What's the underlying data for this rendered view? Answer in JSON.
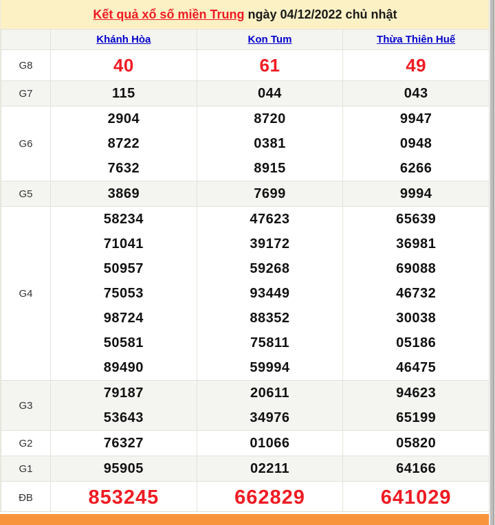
{
  "title": {
    "link": "Kết quả xổ số miền Trung",
    "rest": " ngày 04/12/2022 chủ nhật"
  },
  "table": {
    "columns": [
      "Khánh Hòa",
      "Kon Tum",
      "Thừa Thiên Huế"
    ],
    "rows": [
      {
        "label": "G8",
        "style": "red-medium",
        "stripe": false,
        "values": [
          [
            "40"
          ],
          [
            "61"
          ],
          [
            "49"
          ]
        ]
      },
      {
        "label": "G7",
        "style": "normal",
        "stripe": true,
        "values": [
          [
            "115"
          ],
          [
            "044"
          ],
          [
            "043"
          ]
        ]
      },
      {
        "label": "G6",
        "style": "normal",
        "stripe": false,
        "values": [
          [
            "2904",
            "8722",
            "7632"
          ],
          [
            "8720",
            "0381",
            "8915"
          ],
          [
            "9947",
            "0948",
            "6266"
          ]
        ]
      },
      {
        "label": "G5",
        "style": "normal",
        "stripe": true,
        "values": [
          [
            "3869"
          ],
          [
            "7699"
          ],
          [
            "9994"
          ]
        ]
      },
      {
        "label": "G4",
        "style": "normal",
        "stripe": false,
        "values": [
          [
            "58234",
            "71041",
            "50957",
            "75053",
            "98724",
            "50581",
            "89490"
          ],
          [
            "47623",
            "39172",
            "59268",
            "93449",
            "88352",
            "75811",
            "59994"
          ],
          [
            "65639",
            "36981",
            "69088",
            "46732",
            "30038",
            "05186",
            "46475"
          ]
        ]
      },
      {
        "label": "G3",
        "style": "normal",
        "stripe": true,
        "values": [
          [
            "79187",
            "53643"
          ],
          [
            "20611",
            "34976"
          ],
          [
            "94623",
            "65199"
          ]
        ]
      },
      {
        "label": "G2",
        "style": "normal",
        "stripe": false,
        "values": [
          [
            "76327"
          ],
          [
            "01066"
          ],
          [
            "05820"
          ]
        ]
      },
      {
        "label": "G1",
        "style": "normal",
        "stripe": true,
        "values": [
          [
            "95905"
          ],
          [
            "02211"
          ],
          [
            "64166"
          ]
        ]
      },
      {
        "label": "ĐB",
        "style": "red-large",
        "stripe": false,
        "values": [
          [
            "853245"
          ],
          [
            "662829"
          ],
          [
            "641029"
          ]
        ]
      }
    ]
  },
  "colors": {
    "title_background": "#fcf1c5",
    "accent_red": "#ef1b23",
    "link_blue": "#0000cc",
    "stripe_gray": "#f4f4f1",
    "bottom_bar_orange": "#f8953c"
  }
}
